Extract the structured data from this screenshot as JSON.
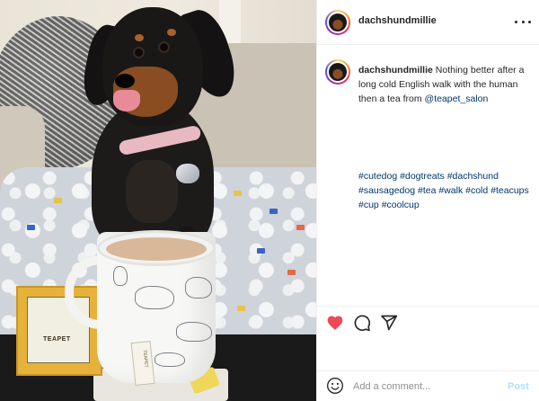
{
  "post": {
    "username": "dachshundmillie",
    "caption_text": "Nothing better after a long cold English walk with the human then a tea from ",
    "caption_mention": "@teapet_salon",
    "hashtags": [
      "#cutedog",
      "#dogtreats",
      "#dachshund",
      "#sausagedog",
      "#tea",
      "#walk",
      "#cold",
      "#teacups",
      "#cup",
      "#coolcup"
    ]
  },
  "photo": {
    "teabag_brand": "TEAPET"
  },
  "actions": {
    "like_icon": "heart-filled-icon",
    "comment_icon": "comment-icon",
    "share_icon": "paper-plane-icon",
    "like_color": "#ed4956"
  },
  "comment_bar": {
    "placeholder": "Add a comment...",
    "post_label": "Post",
    "emoji_icon": "emoji-icon"
  },
  "colors": {
    "link": "#00376b",
    "post_disabled": "#b2dffc",
    "text": "#262626"
  }
}
